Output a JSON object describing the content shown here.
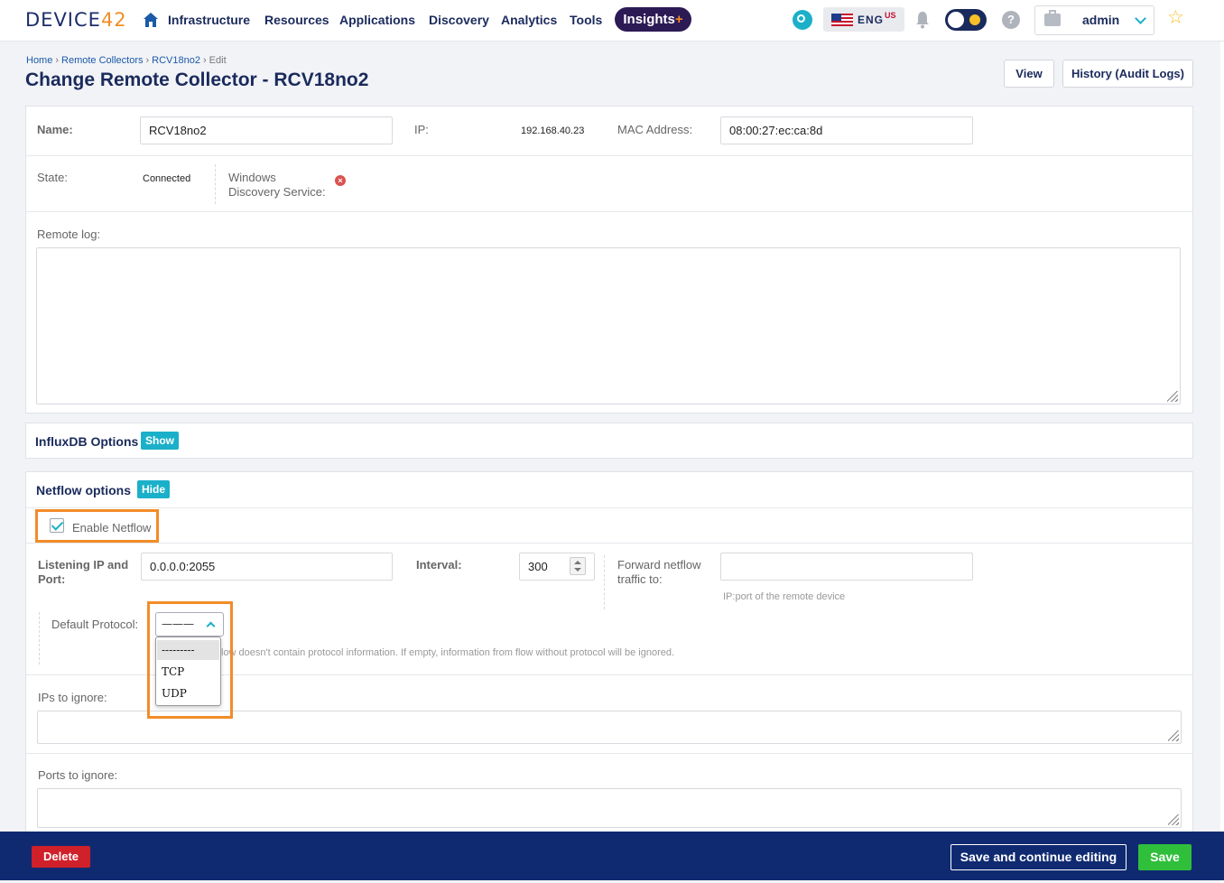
{
  "nav": {
    "logo_main": "DEVICE",
    "logo_num": "42",
    "items": [
      "Infrastructure",
      "Resources",
      "Applications",
      "Discovery",
      "Analytics",
      "Tools"
    ],
    "insights": "Insights",
    "insights_plus": "+",
    "lang": "ENG",
    "lang_region": "US",
    "help": "?",
    "user": "admin",
    "star": "☆"
  },
  "breadcrumb": [
    "Home",
    "Remote Collectors",
    "RCV18no2",
    "Edit"
  ],
  "page_title": "Change Remote Collector - RCV18no2",
  "header_buttons": {
    "view": "View",
    "history": "History (Audit Logs)"
  },
  "form": {
    "name_label": "Name:",
    "name_value": "RCV18no2",
    "ip_label": "IP:",
    "ip_value": "192.168.40.23",
    "mac_label": "MAC Address:",
    "mac_value": "08:00:27:ec:ca:8d",
    "state_label": "State:",
    "state_value": "Connected",
    "wds_label_1": "Windows",
    "wds_label_2": "Discovery Service:",
    "remote_log_label": "Remote log:"
  },
  "influx": {
    "title": "InfluxDB Options",
    "toggle": "Show"
  },
  "netflow": {
    "title": "Netflow options",
    "toggle": "Hide",
    "enable_label": "Enable Netflow",
    "enable_checked": true,
    "listen_label_1": "Listening IP and",
    "listen_label_2": "Port:",
    "listen_value": "0.0.0.0:2055",
    "interval_label": "Interval:",
    "interval_value": "300",
    "forward_label_1": "Forward netflow",
    "forward_label_2": "traffic to:",
    "forward_value": "",
    "forward_help": "IP:port of the remote device",
    "protocol_label": "Default Protocol:",
    "protocol_selected": "———",
    "protocol_options": [
      "---------",
      "TCP",
      "UDP"
    ],
    "protocol_help": "low doesn't contain protocol information. If empty, information from flow without protocol will be ignored.",
    "ips_ignore_label": "IPs to ignore:",
    "ports_ignore_label": "Ports to ignore:"
  },
  "footer": {
    "delete": "Delete",
    "save_continue": "Save and continue editing",
    "save": "Save"
  },
  "colors": {
    "navy": "#1a2a5c",
    "accent": "#1bb0c9",
    "highlight": "#f28c28",
    "footer": "#102a72",
    "danger": "#d0202a",
    "success": "#2fbf3a"
  }
}
